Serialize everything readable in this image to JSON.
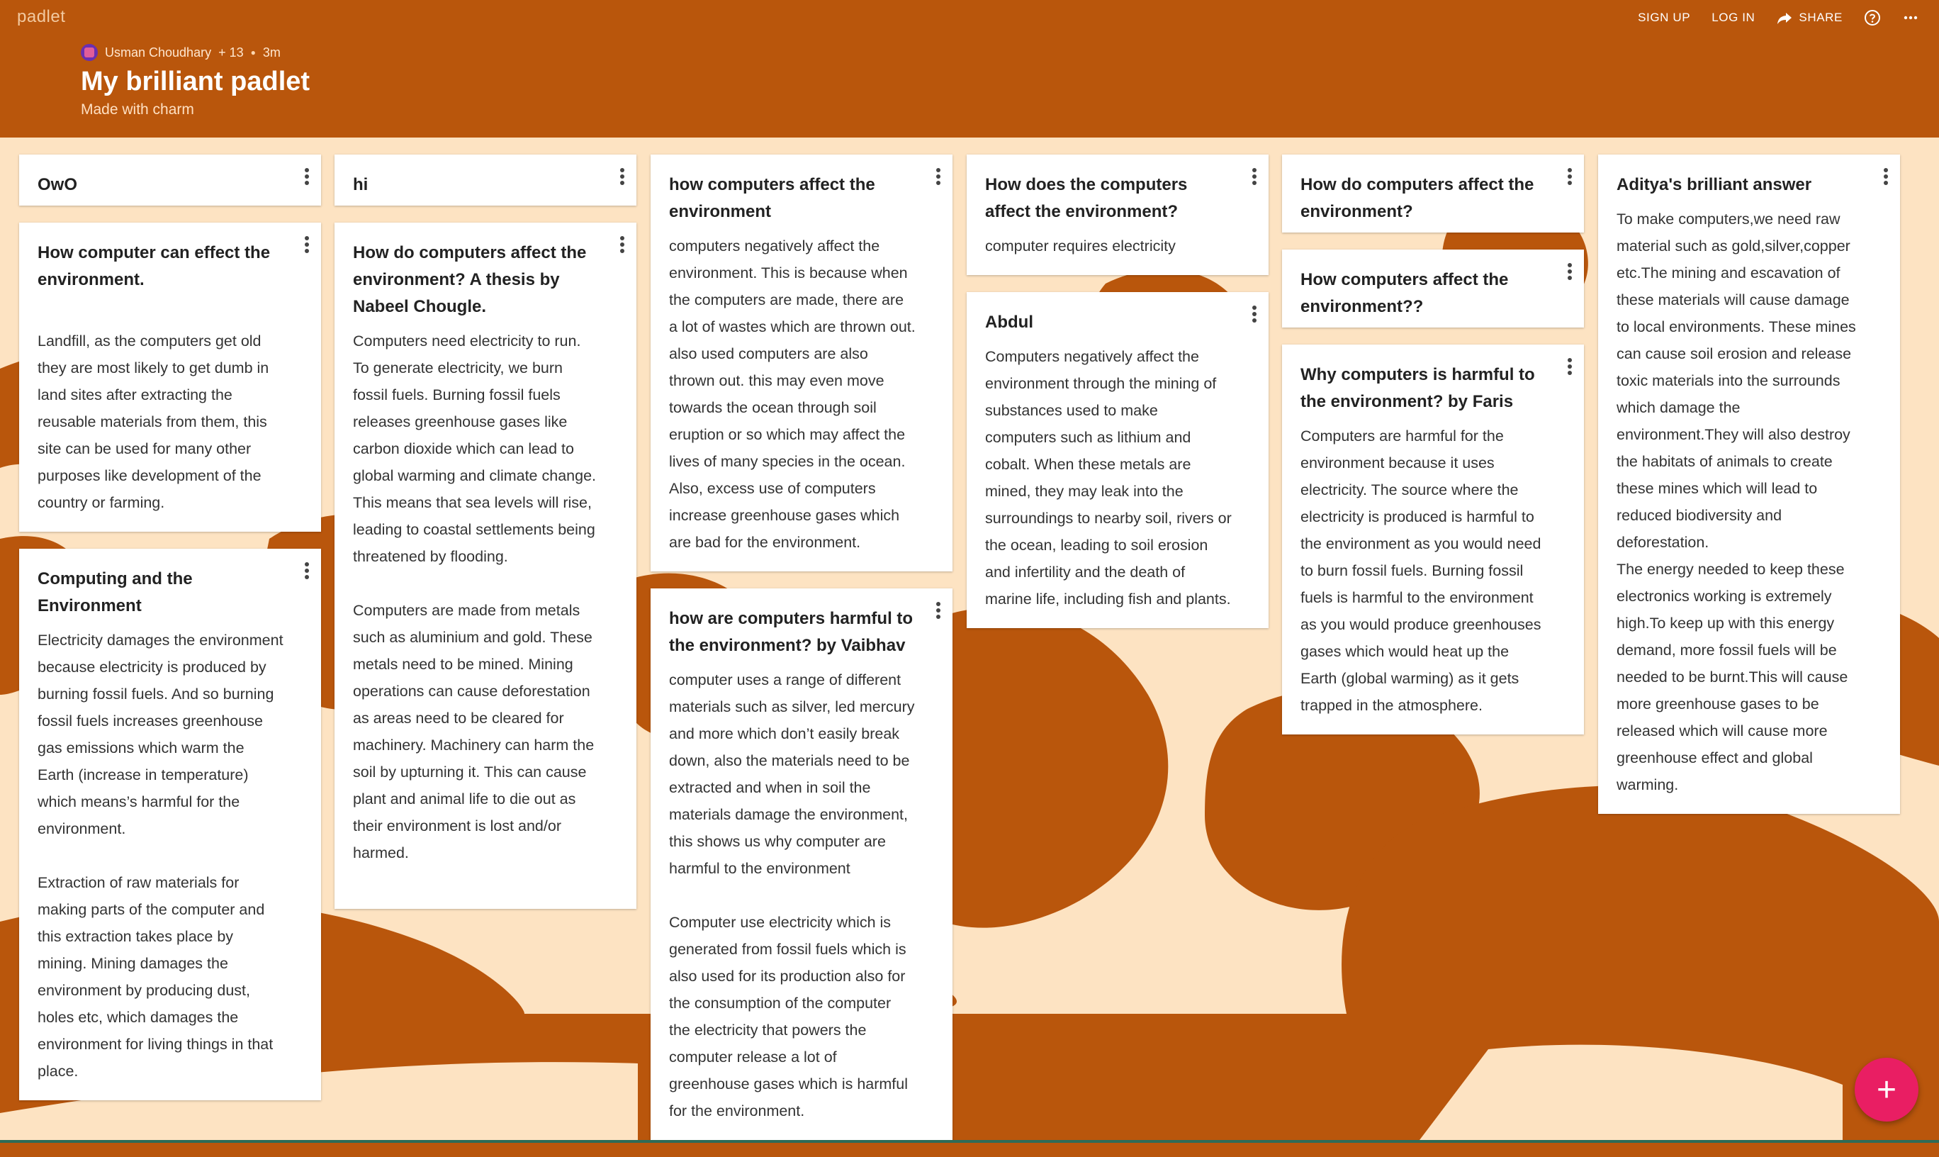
{
  "colors": {
    "background": "#b9560c",
    "pattern": "#fde3c2",
    "fab": "#e91e63"
  },
  "topbar": {
    "logo": "padlet",
    "nav": {
      "signup": "SIGN UP",
      "login": "LOG IN",
      "share": "SHARE"
    },
    "icons": {
      "share": "share-arrow-icon",
      "help": "help-circle-icon",
      "more": "more-horiz-icon"
    }
  },
  "header": {
    "author": "Usman Choudhary",
    "contributors": "+ 13",
    "time": "3m",
    "title": "My brilliant padlet",
    "subtitle": "Made with charm"
  },
  "columns": [
    {
      "cards": [
        {
          "title": "OwO",
          "body": ""
        },
        {
          "title": "How computer can effect the environment.",
          "body": "\nLandfill, as the computers get old they are most likely to get dumb in land sites after extracting the reusable materials from them, this site can be used for many other purposes like development of the country or farming."
        },
        {
          "title": "Computing and the Environment",
          "body": "Electricity damages the environment because electricity is produced by burning fossil fuels. And so burning fossil fuels increases greenhouse gas emissions which warm the Earth (increase in temperature) which means’s harmful for the environment.\n\nExtraction of raw materials for making parts of the computer and this extraction takes place by mining. Mining damages the environment by producing dust, holes etc, which damages the environment for living things in that place."
        }
      ]
    },
    {
      "cards": [
        {
          "title": "hi",
          "body": ""
        },
        {
          "title": "How do computers affect the environment? A thesis by Nabeel Chougle.",
          "body": "Computers need electricity to run. To generate electricity, we burn fossil fuels. Burning fossil fuels releases greenhouse gases like carbon dioxide which can lead to global warming and climate change. This means that sea levels will rise, leading to coastal settlements being threatened by flooding.\n\nComputers are made from metals such as aluminium and gold. These metals need to be mined. Mining operations can cause deforestation as areas need to be cleared for machinery. Machinery can harm the soil by upturning it. This can cause plant and animal life to die out as their environment is lost and/or harmed.\n\n"
        }
      ]
    },
    {
      "cards": [
        {
          "title": "how computers affect the environment",
          "body": "computers negatively affect the environment. This is because when the computers are made, there are a lot of wastes which are thrown out. also used computers are also thrown out. this may even move towards the ocean through soil eruption or so which may affect the lives of many species in the ocean. Also, excess use of computers increase greenhouse gases which are bad for the environment."
        },
        {
          "title": "how are computers harmful to the environment? by Vaibhav",
          "body": "computer uses a range of different materials such as silver, led mercury and more which don’t easily break down, also the materials need to be extracted  and when in soil the materials damage the environment, this shows us why computer are harmful to the environment\n\nComputer use electricity which is generated from fossil fuels which is also used for its production also for the consumption of the computer the electricity that powers the computer release a lot of greenhouse gases which is harmful for the environment."
        }
      ]
    },
    {
      "cards": [
        {
          "title": "How does the computers affect the environment?",
          "body": "computer requires electricity"
        },
        {
          "title": "Abdul",
          "body": "Computers negatively affect the environment through the mining of substances used to make computers such as lithium and cobalt. When these metals are mined, they may leak into the surroundings to nearby soil, rivers or the ocean, leading to soil erosion and infertility and the death of marine life, including fish and plants."
        }
      ]
    },
    {
      "cards": [
        {
          "title": "How do computers affect the environment?",
          "body": ""
        },
        {
          "title": "How computers affect the environment??",
          "body": ""
        },
        {
          "title": "Why computers is harmful to the environment? by Faris",
          "body": "Computers are harmful for the environment because it uses electricity.  The source where the electricity is produced is harmful to the environment as you would need to burn fossil fuels. Burning fossil fuels is harmful to the environment as you would produce greenhouses gases which would heat up the Earth (global warming) as it gets trapped in the atmosphere."
        }
      ]
    },
    {
      "cards": [
        {
          "title": "Aditya's brilliant answer",
          "body": "To make computers,we need raw material such as gold,silver,copper etc.The mining and escavation of these materials will cause damage to local environments. These mines can cause soil erosion and release toxic materials into the surrounds which damage the environment.They will also destroy the habitats of animals to create these mines which will lead to reduced biodiversity and deforestation.\nThe energy needed to keep these electronics working is extremely high.To keep up with this energy demand, more fossil fuels will be needed to be burnt.This will cause more greenhouse gases to be released which will cause more greenhouse effect and global warming."
        }
      ]
    }
  ],
  "fab": {
    "label": "+",
    "icon": "plus-icon"
  }
}
